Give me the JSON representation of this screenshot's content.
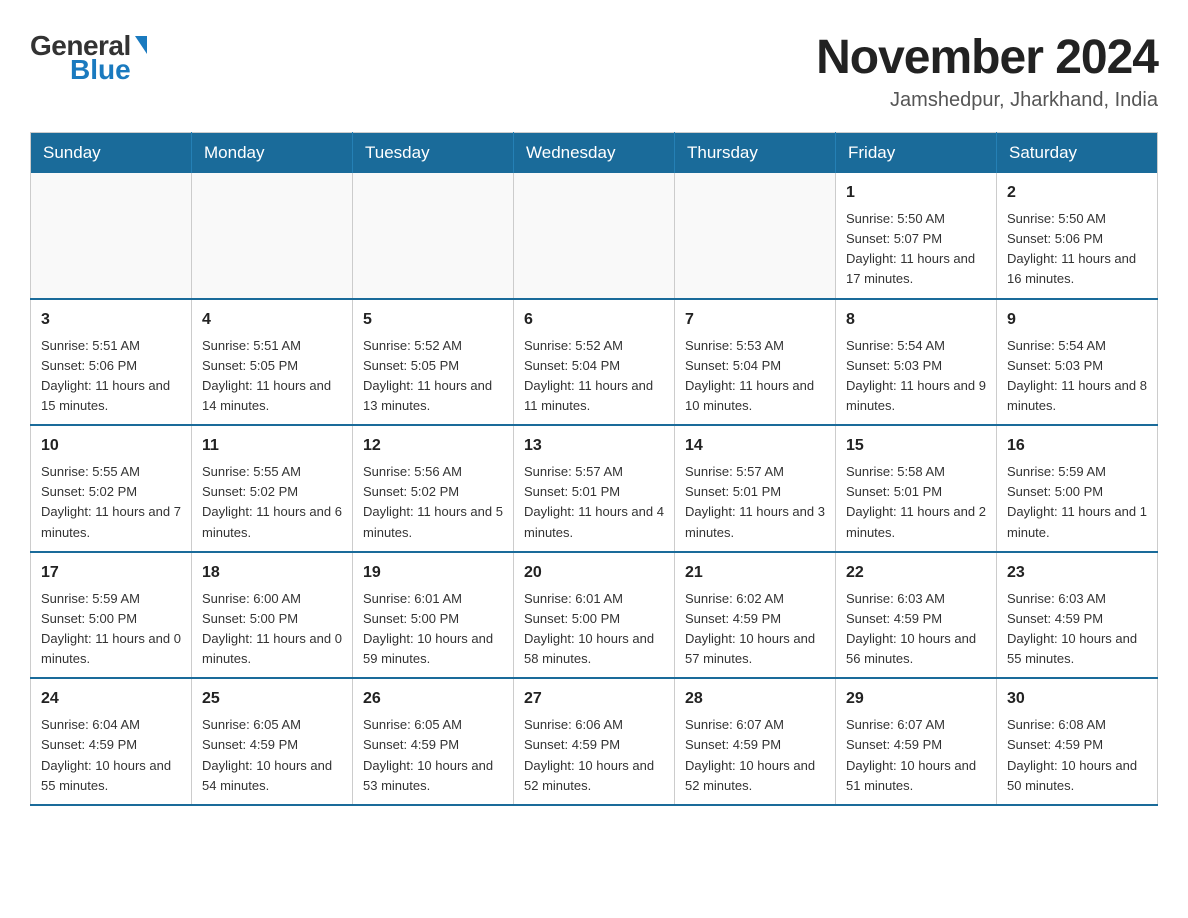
{
  "logo": {
    "general": "General",
    "blue": "Blue",
    "triangle": "▶"
  },
  "title": "November 2024",
  "location": "Jamshedpur, Jharkhand, India",
  "weekdays": [
    "Sunday",
    "Monday",
    "Tuesday",
    "Wednesday",
    "Thursday",
    "Friday",
    "Saturday"
  ],
  "weeks": [
    [
      {
        "day": "",
        "info": ""
      },
      {
        "day": "",
        "info": ""
      },
      {
        "day": "",
        "info": ""
      },
      {
        "day": "",
        "info": ""
      },
      {
        "day": "",
        "info": ""
      },
      {
        "day": "1",
        "info": "Sunrise: 5:50 AM\nSunset: 5:07 PM\nDaylight: 11 hours and 17 minutes."
      },
      {
        "day": "2",
        "info": "Sunrise: 5:50 AM\nSunset: 5:06 PM\nDaylight: 11 hours and 16 minutes."
      }
    ],
    [
      {
        "day": "3",
        "info": "Sunrise: 5:51 AM\nSunset: 5:06 PM\nDaylight: 11 hours and 15 minutes."
      },
      {
        "day": "4",
        "info": "Sunrise: 5:51 AM\nSunset: 5:05 PM\nDaylight: 11 hours and 14 minutes."
      },
      {
        "day": "5",
        "info": "Sunrise: 5:52 AM\nSunset: 5:05 PM\nDaylight: 11 hours and 13 minutes."
      },
      {
        "day": "6",
        "info": "Sunrise: 5:52 AM\nSunset: 5:04 PM\nDaylight: 11 hours and 11 minutes."
      },
      {
        "day": "7",
        "info": "Sunrise: 5:53 AM\nSunset: 5:04 PM\nDaylight: 11 hours and 10 minutes."
      },
      {
        "day": "8",
        "info": "Sunrise: 5:54 AM\nSunset: 5:03 PM\nDaylight: 11 hours and 9 minutes."
      },
      {
        "day": "9",
        "info": "Sunrise: 5:54 AM\nSunset: 5:03 PM\nDaylight: 11 hours and 8 minutes."
      }
    ],
    [
      {
        "day": "10",
        "info": "Sunrise: 5:55 AM\nSunset: 5:02 PM\nDaylight: 11 hours and 7 minutes."
      },
      {
        "day": "11",
        "info": "Sunrise: 5:55 AM\nSunset: 5:02 PM\nDaylight: 11 hours and 6 minutes."
      },
      {
        "day": "12",
        "info": "Sunrise: 5:56 AM\nSunset: 5:02 PM\nDaylight: 11 hours and 5 minutes."
      },
      {
        "day": "13",
        "info": "Sunrise: 5:57 AM\nSunset: 5:01 PM\nDaylight: 11 hours and 4 minutes."
      },
      {
        "day": "14",
        "info": "Sunrise: 5:57 AM\nSunset: 5:01 PM\nDaylight: 11 hours and 3 minutes."
      },
      {
        "day": "15",
        "info": "Sunrise: 5:58 AM\nSunset: 5:01 PM\nDaylight: 11 hours and 2 minutes."
      },
      {
        "day": "16",
        "info": "Sunrise: 5:59 AM\nSunset: 5:00 PM\nDaylight: 11 hours and 1 minute."
      }
    ],
    [
      {
        "day": "17",
        "info": "Sunrise: 5:59 AM\nSunset: 5:00 PM\nDaylight: 11 hours and 0 minutes."
      },
      {
        "day": "18",
        "info": "Sunrise: 6:00 AM\nSunset: 5:00 PM\nDaylight: 11 hours and 0 minutes."
      },
      {
        "day": "19",
        "info": "Sunrise: 6:01 AM\nSunset: 5:00 PM\nDaylight: 10 hours and 59 minutes."
      },
      {
        "day": "20",
        "info": "Sunrise: 6:01 AM\nSunset: 5:00 PM\nDaylight: 10 hours and 58 minutes."
      },
      {
        "day": "21",
        "info": "Sunrise: 6:02 AM\nSunset: 4:59 PM\nDaylight: 10 hours and 57 minutes."
      },
      {
        "day": "22",
        "info": "Sunrise: 6:03 AM\nSunset: 4:59 PM\nDaylight: 10 hours and 56 minutes."
      },
      {
        "day": "23",
        "info": "Sunrise: 6:03 AM\nSunset: 4:59 PM\nDaylight: 10 hours and 55 minutes."
      }
    ],
    [
      {
        "day": "24",
        "info": "Sunrise: 6:04 AM\nSunset: 4:59 PM\nDaylight: 10 hours and 55 minutes."
      },
      {
        "day": "25",
        "info": "Sunrise: 6:05 AM\nSunset: 4:59 PM\nDaylight: 10 hours and 54 minutes."
      },
      {
        "day": "26",
        "info": "Sunrise: 6:05 AM\nSunset: 4:59 PM\nDaylight: 10 hours and 53 minutes."
      },
      {
        "day": "27",
        "info": "Sunrise: 6:06 AM\nSunset: 4:59 PM\nDaylight: 10 hours and 52 minutes."
      },
      {
        "day": "28",
        "info": "Sunrise: 6:07 AM\nSunset: 4:59 PM\nDaylight: 10 hours and 52 minutes."
      },
      {
        "day": "29",
        "info": "Sunrise: 6:07 AM\nSunset: 4:59 PM\nDaylight: 10 hours and 51 minutes."
      },
      {
        "day": "30",
        "info": "Sunrise: 6:08 AM\nSunset: 4:59 PM\nDaylight: 10 hours and 50 minutes."
      }
    ]
  ]
}
